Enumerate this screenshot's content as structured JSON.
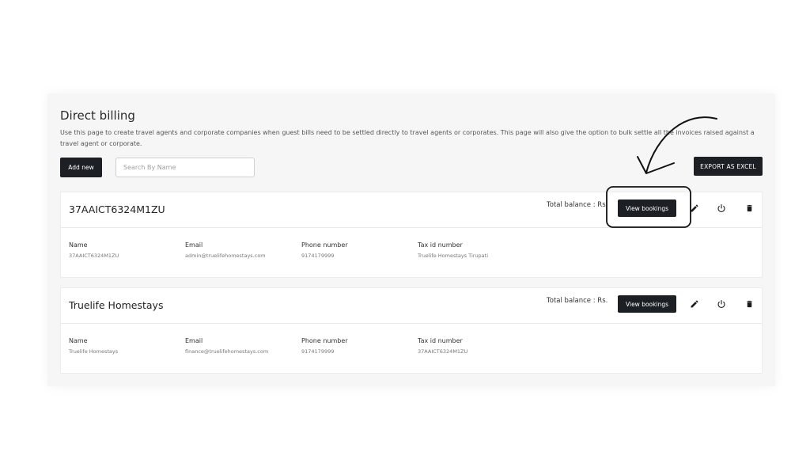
{
  "page": {
    "title": "Direct billing",
    "description": "Use this page to create travel agents and corporate companies when guest bills need to be settled directly to travel agents or corporates. This page will also give the option to bulk settle all the invoices raised against a travel agent or corporate.",
    "add_label": "Add new",
    "search_placeholder": "Search By Name",
    "export_label": "EXPORT AS EXCEL"
  },
  "cards": [
    {
      "title": "37AAICT6324M1ZU",
      "balance_label": "Total balance : Rs.",
      "view_label": "View bookings",
      "fields": [
        {
          "label": "Name",
          "value": "37AAICT6324M1ZU"
        },
        {
          "label": "Email",
          "value": "admin@truelifehomestays.com"
        },
        {
          "label": "Phone number",
          "value": "9174179999"
        },
        {
          "label": "Tax id number",
          "value": "Truelife Homestays Tirupati"
        }
      ]
    },
    {
      "title": "Truelife Homestays",
      "balance_label": "Total balance : Rs.",
      "view_label": "View bookings",
      "fields": [
        {
          "label": "Name",
          "value": "Truelife Homestays"
        },
        {
          "label": "Email",
          "value": "finance@truelifehomestays.com"
        },
        {
          "label": "Phone number",
          "value": "9174179999"
        },
        {
          "label": "Tax id number",
          "value": "37AAICT6324M1ZU"
        }
      ]
    }
  ],
  "icons": [
    "edit-icon",
    "power-icon",
    "trash-icon"
  ],
  "colors": {
    "button_dark": "#1c1f24",
    "background": "#f6f6f7"
  }
}
